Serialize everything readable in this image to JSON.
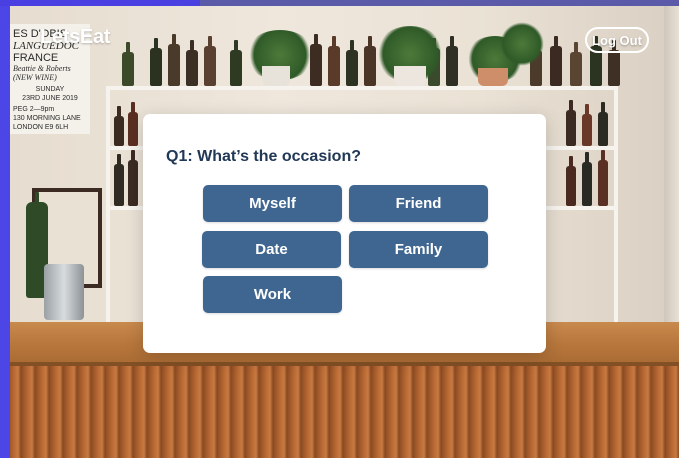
{
  "header": {
    "logo": "LetsEat",
    "logout_label": "Log Out"
  },
  "poster": {
    "lines": [
      "ES D'OBIS",
      "LANGUEDOC",
      "FRANCE",
      "Beattie & Roberts",
      "(NEW WINE)",
      "SUNDAY",
      "23RD JUNE 2019",
      "PEG 2—9pm",
      "130 MORNING LANE",
      "LONDON E9 6LH"
    ]
  },
  "quiz": {
    "question": "Q1: What’s the occasion?",
    "options": [
      "Myself",
      "Friend",
      "Date",
      "Family",
      "Work"
    ]
  },
  "colors": {
    "button_bg": "#3f6690",
    "question_text": "#223857",
    "accent_strip": "#4c46e6"
  }
}
